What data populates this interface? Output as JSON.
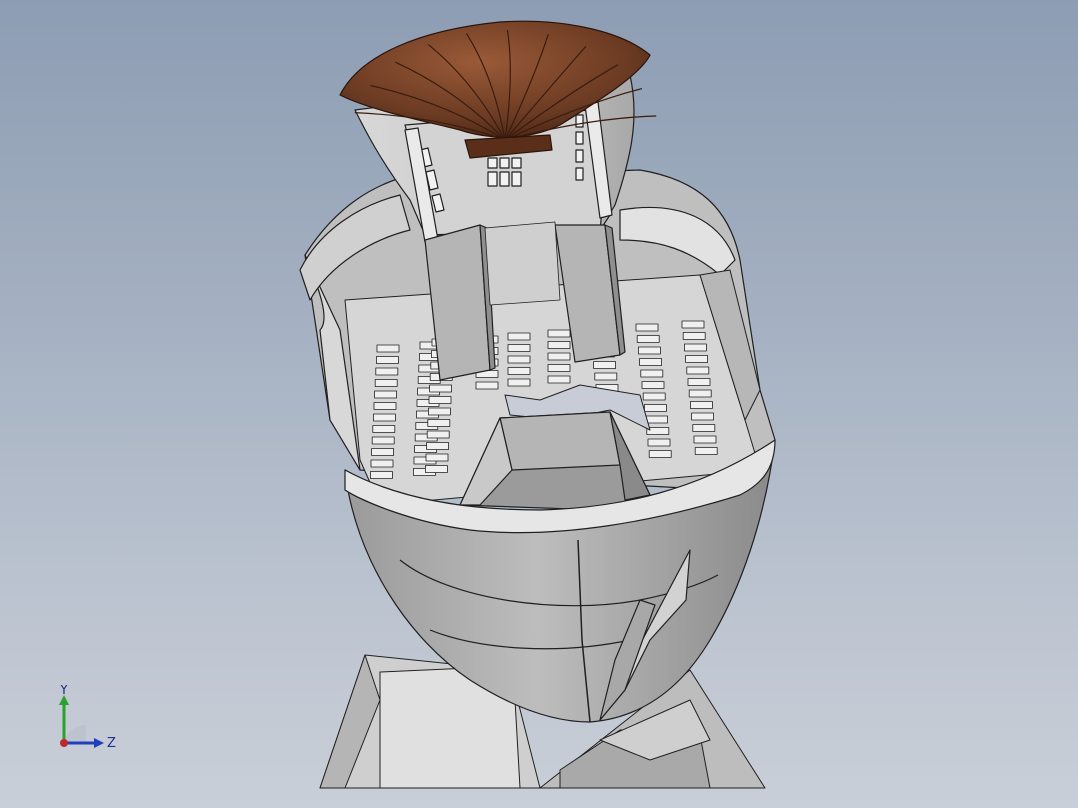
{
  "viewport": {
    "background_top": "#8d9db3",
    "background_bottom": "#c9cfd8"
  },
  "model": {
    "body_color": "#c2c2c2",
    "shade_color": "#8f8f8f",
    "light_color": "#e4e4e4",
    "edge_color": "#202020",
    "dome_color": "#6a3a22",
    "dome_highlight": "#9a5a38"
  },
  "triad": {
    "y_label": "Y",
    "z_label": "Z",
    "y_color": "#2ca02c",
    "z_color": "#1f3fbf",
    "x_color": "#c0262b"
  }
}
